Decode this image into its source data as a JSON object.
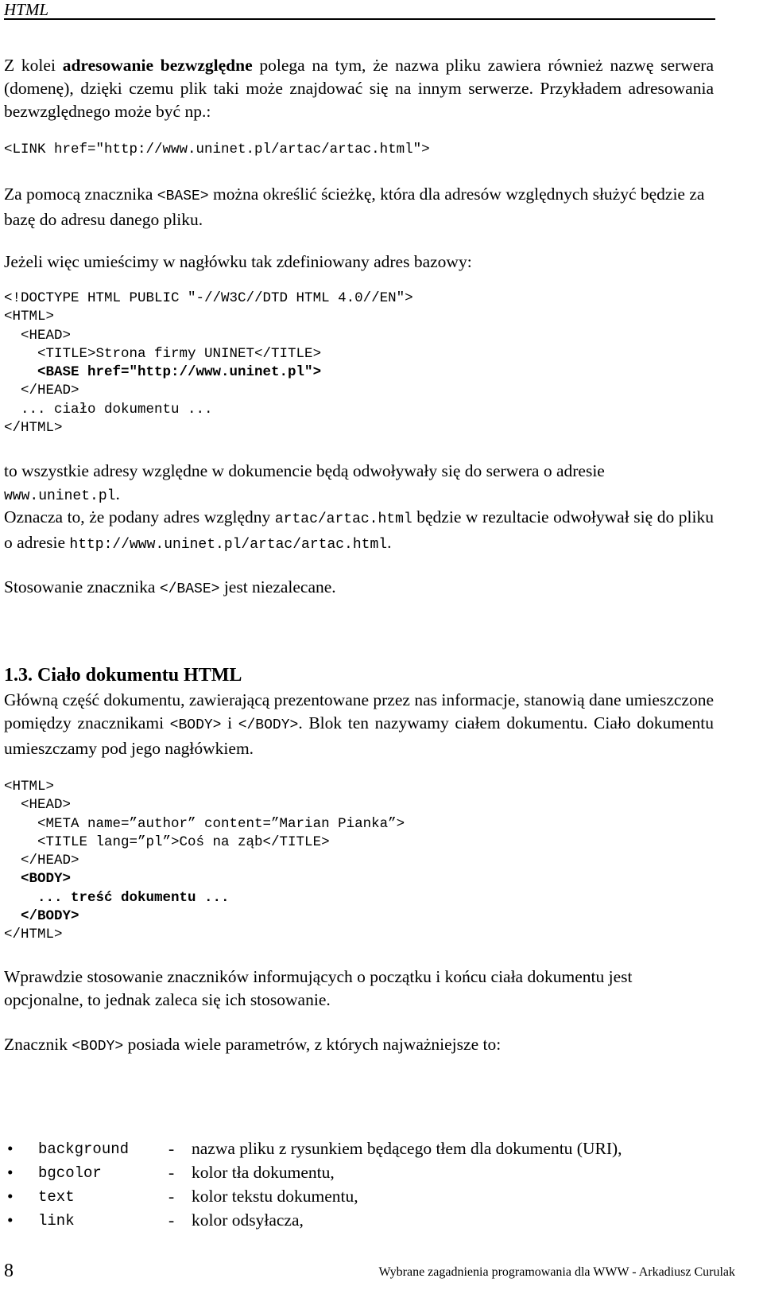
{
  "header": {
    "title": "HTML"
  },
  "para1": {
    "pre": "Z kolei ",
    "bold": "adresowanie bezwzględne",
    "post": " polega na tym, że nazwa pliku zawiera również nazwę serwera (domenę), dzięki czemu plik taki może znajdować się na innym serwerze. Przykładem adresowania bezwzględnego może być np.:"
  },
  "code_link": "<LINK href=\"http://www.uninet.pl/artac/artac.html\">",
  "para2": {
    "pre": "Za pomocą znacznika ",
    "tag": "<BASE>",
    "post": " można określić ścieżkę, która dla adresów względnych służyć będzie za bazę do adresu danego pliku."
  },
  "para3": "Jeżeli więc umieścimy w nagłówku tak zdefiniowany adres bazowy:",
  "code_block1": [
    {
      "text": "<!DOCTYPE HTML PUBLIC \"-//W3C//DTD HTML 4.0//EN\">",
      "bold": false
    },
    {
      "text": "<HTML>",
      "bold": false
    },
    {
      "text": "  <HEAD>",
      "bold": false
    },
    {
      "text": "    <TITLE>Strona firmy UNINET</TITLE>",
      "bold": false
    },
    {
      "text": "    <BASE href=\"http://www.uninet.pl\">",
      "bold": true
    },
    {
      "text": "  </HEAD>",
      "bold": false
    },
    {
      "text": "  ... ciało dokumentu ...",
      "bold": false
    },
    {
      "text": "</HTML>",
      "bold": false
    }
  ],
  "para4": {
    "line1": "to wszystkie adresy względne w dokumencie będą odwoływały się do serwera o  adresie",
    "domain": "www.uninet.pl",
    "dot": "."
  },
  "para5": {
    "pre": "Oznacza to, że podany adres względny ",
    "rel": "artac/artac.html",
    "mid": " będzie w rezultacie odwoływał się do pliku o adresie ",
    "abs": "http://www.uninet.pl/artac/artac.html",
    "post": "."
  },
  "para6": {
    "pre": "Stosowanie znacznika ",
    "tag": "</BASE>",
    "post": " jest niezalecane."
  },
  "section_heading": "1.3. Ciało dokumentu HTML",
  "para7": {
    "pre": "Główną część dokumentu, zawierającą prezentowane przez nas informacje, stanowią dane umieszczone pomiędzy znacznikami ",
    "tag1": "<BODY>",
    "mid": " i ",
    "tag2": "</BODY>",
    "post": ". Blok ten nazywamy ciałem dokumentu. Ciało dokumentu umieszczamy pod jego nagłówkiem."
  },
  "code_block2": [
    {
      "text": "<HTML>",
      "bold": false
    },
    {
      "text": "  <HEAD>",
      "bold": false
    },
    {
      "text": "    <META name=”author” content=”Marian Pianka”>",
      "bold": false
    },
    {
      "text": "    <TITLE lang=”pl”>Coś na ząb</TITLE>",
      "bold": false
    },
    {
      "text": "  </HEAD>",
      "bold": false
    },
    {
      "text": "  <BODY>",
      "bold": true
    },
    {
      "text": "    ... treść dokumentu ...",
      "bold": true
    },
    {
      "text": "  </BODY>",
      "bold": true
    },
    {
      "text": "</HTML>",
      "bold": false
    }
  ],
  "para8": "Wprawdzie stosowanie znaczników informujących o początku i końcu ciała dokumentu jest opcjonalne, to jednak zaleca się ich stosowanie.",
  "para9": {
    "pre": "Znacznik ",
    "tag": "<BODY>",
    "post": " posiada wiele parametrów, z których najważniejsze to:"
  },
  "params": [
    {
      "bullet": "•",
      "name": "background",
      "dash": "-",
      "desc": "nazwa pliku z rysunkiem będącego tłem dla dokumentu (URI),"
    },
    {
      "bullet": "•",
      "name": "bgcolor",
      "dash": "-",
      "desc": "kolor tła dokumentu,"
    },
    {
      "bullet": "•",
      "name": "text",
      "dash": "-",
      "desc": "kolor tekstu dokumentu,"
    },
    {
      "bullet": "•",
      "name": "link",
      "dash": "-",
      "desc": "kolor odsyłacza,"
    }
  ],
  "footer": {
    "page_number": "8",
    "text": "Wybrane zagadnienia programowania dla WWW - Arkadiusz Curulak"
  }
}
